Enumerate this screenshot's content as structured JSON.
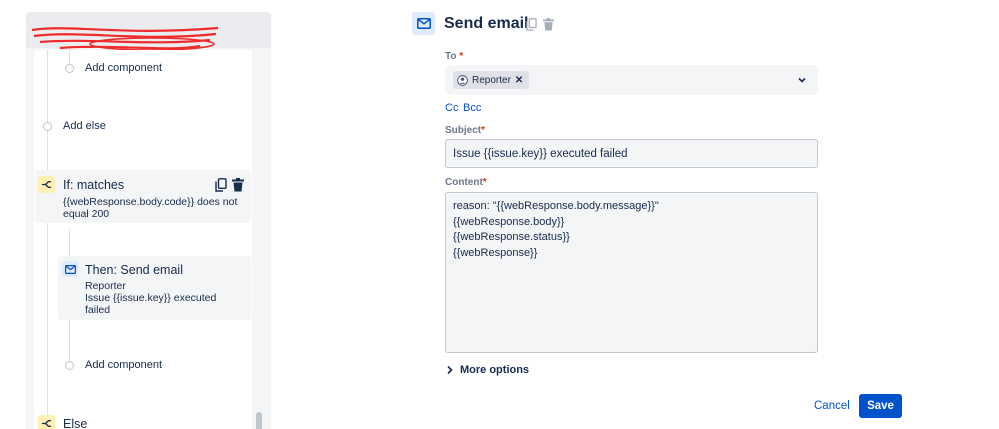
{
  "left": {
    "add_component_top": "Add component",
    "add_else": "Add else",
    "if_title": "If: matches",
    "if_desc_line1": "{{webResponse.body.code}} does not",
    "if_desc_line2": "equal 200",
    "then_title": "Then: Send email",
    "then_line1": "Reporter",
    "then_line2": "Issue {{issue.key}} executed",
    "then_line3": "failed",
    "add_component_bottom": "Add component",
    "else_label": "Else"
  },
  "panel": {
    "title": "Send email",
    "to_label": "To",
    "to_chip": "Reporter",
    "cc_label": "Cc",
    "bcc_label": "Bcc",
    "subject_label": "Subject",
    "subject_value": "Issue {{issue.key}} executed failed",
    "content_label": "Content",
    "content_lines": [
      "reason: \"{{webResponse.body.message}}\"",
      "{{webResponse.body}}",
      "{{webResponse.status}}",
      "{{webResponse}}"
    ],
    "more_options": "More options",
    "cancel": "Cancel",
    "save": "Save",
    "required_marker": "*"
  },
  "colors": {
    "primary": "#0052cc",
    "required": "#de350b",
    "condition_icon_bg": "#fff0b3",
    "action_icon_bg": "#deebff"
  },
  "icons": [
    "envelope-icon",
    "copy-icon",
    "trash-icon",
    "branch-icon",
    "user-icon",
    "chevron-down-icon",
    "chevron-right-icon"
  ]
}
